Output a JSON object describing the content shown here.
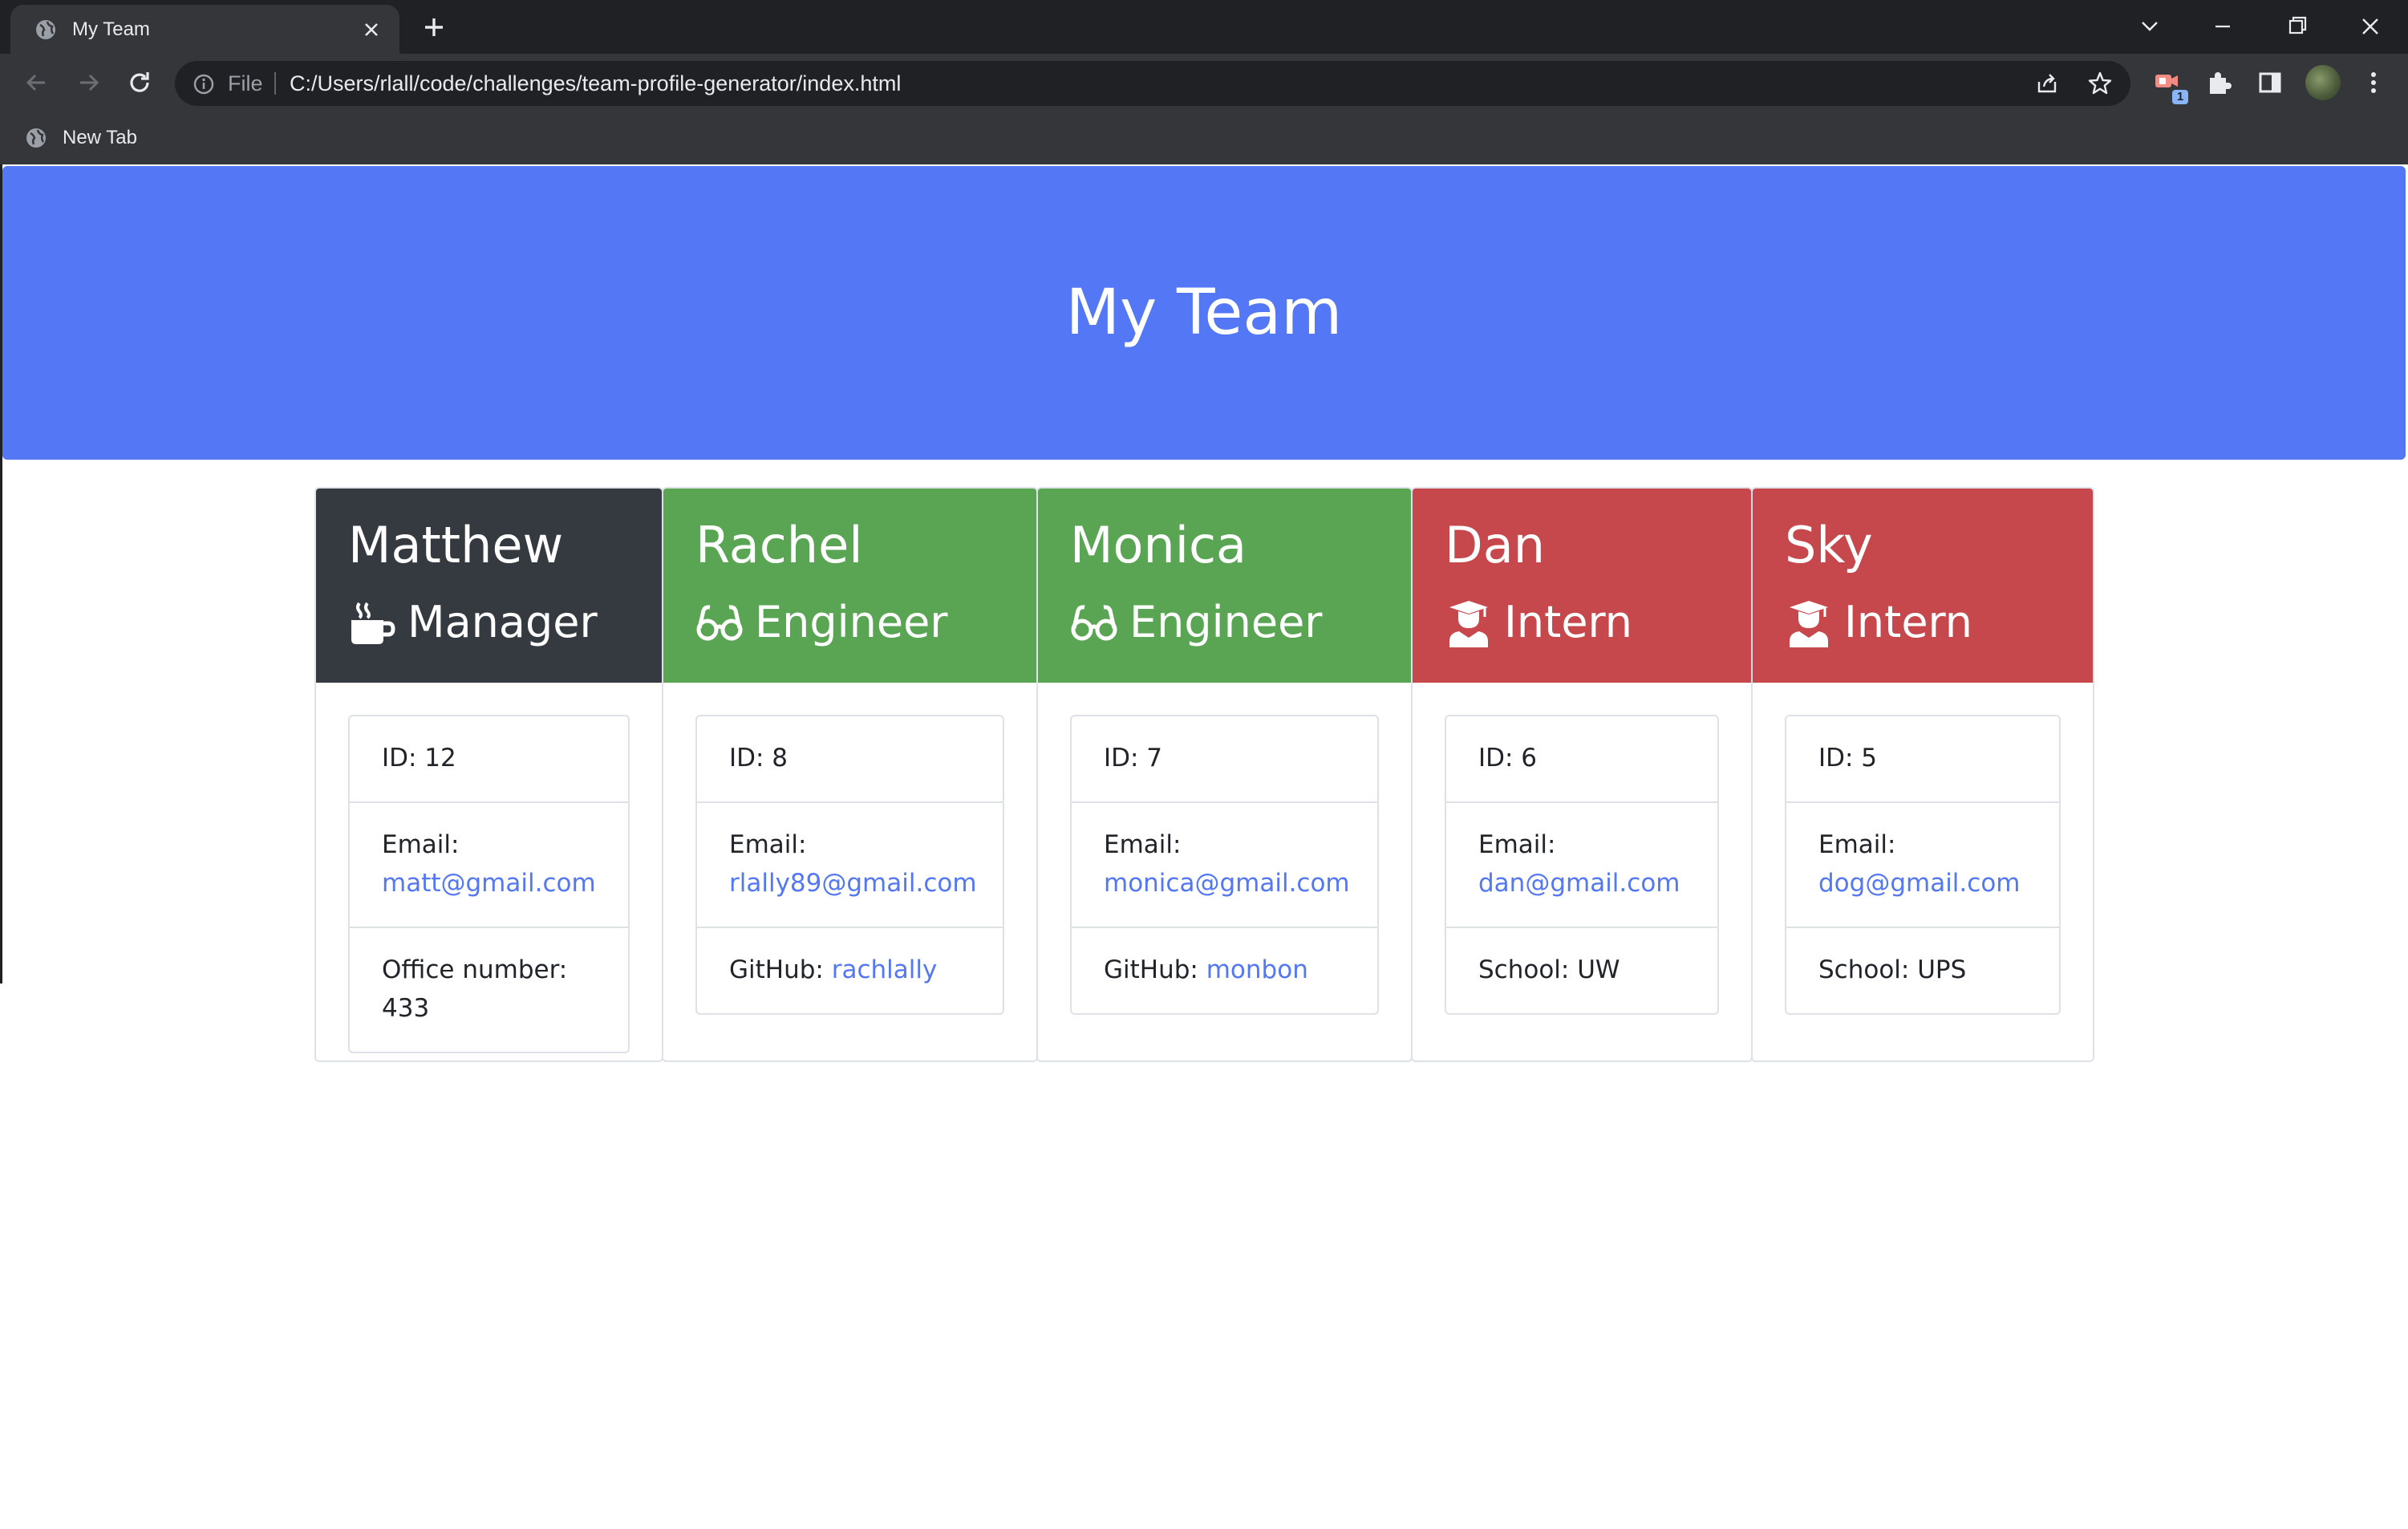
{
  "browser": {
    "tab_title": "My Team",
    "address_scheme": "File",
    "url": "C:/Users/rlall/code/challenges/team-profile-generator/index.html",
    "extension_badge": "1",
    "bookmarks": [
      {
        "label": "New Tab"
      }
    ]
  },
  "page": {
    "title": "My Team",
    "colors": {
      "header": "#5377f5",
      "manager": "#343a40",
      "engineer": "#5aa554",
      "intern": "#c6474c",
      "link": "#5377f5"
    },
    "employees": [
      {
        "name": "Matthew",
        "role": "Manager",
        "icon": "coffee-mug-icon",
        "id_text": "ID: 12",
        "email_label": "Email:",
        "email": "matt@gmail.com",
        "extra_label": "Office number:",
        "extra_value": "433"
      },
      {
        "name": "Rachel",
        "role": "Engineer",
        "icon": "glasses-icon",
        "id_text": "ID: 8",
        "email_label": "Email:",
        "email": "rlally89@gmail.com",
        "extra_label": "GitHub:",
        "extra_value": "rachlally"
      },
      {
        "name": "Monica",
        "role": "Engineer",
        "icon": "glasses-icon",
        "id_text": "ID: 7",
        "email_label": "Email:",
        "email": "monica@gmail.com",
        "extra_label": "GitHub:",
        "extra_value": "monbon"
      },
      {
        "name": "Dan",
        "role": "Intern",
        "icon": "graduate-icon",
        "id_text": "ID: 6",
        "email_label": "Email:",
        "email": "dan@gmail.com",
        "extra_label": "School:",
        "extra_value": "UW"
      },
      {
        "name": "Sky",
        "role": "Intern",
        "icon": "graduate-icon",
        "id_text": "ID: 5",
        "email_label": "Email:",
        "email": "dog@gmail.com",
        "extra_label": "School:",
        "extra_value": "UPS"
      }
    ]
  }
}
